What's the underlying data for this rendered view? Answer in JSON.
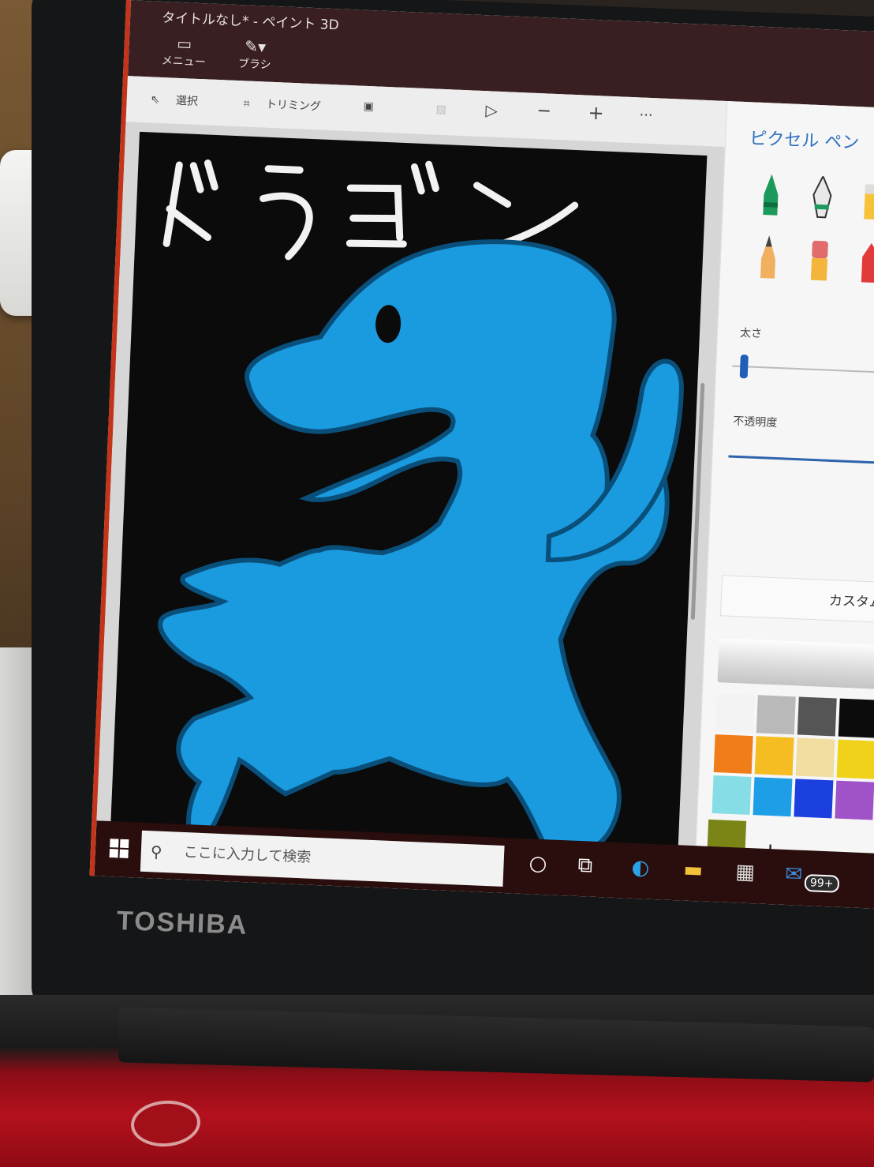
{
  "window": {
    "title": "タイトルなし* - ペイント 3D",
    "menu_label": "メニュー",
    "brush_label": "ブラシ"
  },
  "toolbar": {
    "select_label": "選択",
    "trim_label": "トリミング"
  },
  "canvas": {
    "drawing_text": "ドラゴン",
    "background_color": "#0b0b0b",
    "figure_color": "#1a9be0"
  },
  "panel": {
    "title": "ピクセル ペン",
    "thickness_label": "太さ",
    "opacity_label": "不透明度",
    "custom_label": "カスタム",
    "add_label": "+",
    "swatches": [
      "#f3f3f3",
      "#b9b9b9",
      "#555555",
      "#0c0c0c",
      "#f07d1a",
      "#f5bd22",
      "#f2dda0",
      "#f0d21a",
      "#86dde5",
      "#1f9ee8",
      "#1c3fe0",
      "#a052c8"
    ],
    "selected_color": "#7b8416"
  },
  "taskbar": {
    "search_placeholder": "ここに入力して検索",
    "mail_badge": "99+"
  },
  "device": {
    "brand": "TOSHIBA"
  }
}
